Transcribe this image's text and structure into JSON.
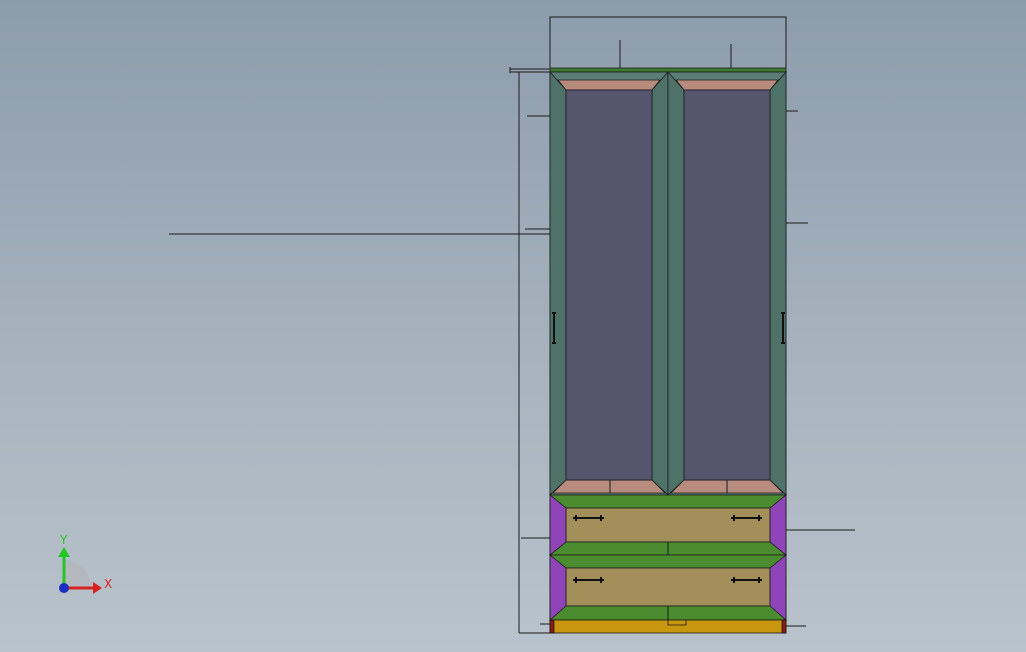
{
  "viewport": {
    "background_top": "#8d9cab",
    "background_bottom": "#b9c3cc"
  },
  "model": {
    "name": "wardrobe-front-view",
    "colors": {
      "frame": "#5c7d74",
      "glass": "#55556e",
      "trim": "#b88b7f",
      "crown": "#4f8a3c",
      "rail_green": "#4a8c2f",
      "drawer_face": "#a38f5a",
      "side_purple": "#8f44b8",
      "base": "#c9960f",
      "base_edge": "#8b1b10",
      "outline": "#1a1a1a"
    },
    "parts": {
      "upper_doors": 2,
      "drawers": 2,
      "drawer_pulls_per_drawer": 2,
      "door_handles": 2
    }
  },
  "triad": {
    "x_label": "X",
    "y_label": "Y",
    "x_color": "#d52222",
    "y_color": "#22c722",
    "z_color": "#1a2fc2"
  }
}
